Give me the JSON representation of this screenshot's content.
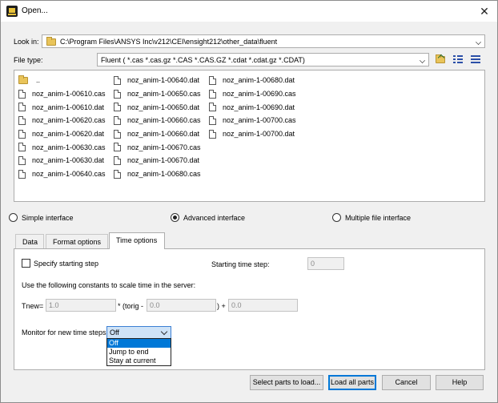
{
  "window": {
    "title": "Open...",
    "close_glyph": "✕"
  },
  "look_in": {
    "label": "Look in:",
    "path": "C:\\Program Files\\ANSYS Inc\\v212\\CEI\\ensight212\\other_data\\fluent"
  },
  "file_type": {
    "label": "File type:",
    "value": "Fluent ( *.cas *.cas.gz *.CAS *.CAS.GZ *.cdat *.cdat.gz *.CDAT)"
  },
  "toolbar": {
    "icons": [
      "up-folder-icon",
      "list-view-icon",
      "details-view-icon"
    ]
  },
  "files": {
    "col1": [
      "..",
      "noz_anim-1-00610.cas",
      "noz_anim-1-00610.dat",
      "noz_anim-1-00620.cas",
      "noz_anim-1-00620.dat",
      "noz_anim-1-00630.cas",
      "noz_anim-1-00630.dat",
      "noz_anim-1-00640.cas"
    ],
    "col2": [
      "noz_anim-1-00640.dat",
      "noz_anim-1-00650.cas",
      "noz_anim-1-00650.dat",
      "noz_anim-1-00660.cas",
      "noz_anim-1-00660.dat",
      "noz_anim-1-00670.cas",
      "noz_anim-1-00670.dat",
      "noz_anim-1-00680.cas"
    ],
    "col3": [
      "noz_anim-1-00680.dat",
      "noz_anim-1-00690.cas",
      "noz_anim-1-00690.dat",
      "noz_anim-1-00700.cas",
      "noz_anim-1-00700.dat"
    ]
  },
  "interface": {
    "simple": "Simple interface",
    "advanced": "Advanced interface",
    "multiple": "Multiple file interface",
    "selected": "advanced"
  },
  "tabs": [
    {
      "label": "Data"
    },
    {
      "label": "Format options"
    },
    {
      "label": "Time options"
    }
  ],
  "time_options": {
    "specify_start_label": "Specify starting step",
    "starting_step_label": "Starting time step:",
    "starting_step_value": "0",
    "constants_text": "Use the following constants to scale time in the server:",
    "tnew_label": "Tnew=",
    "tnew_value": "1.0",
    "torig_label": "* (torig -",
    "torig_value": "0.0",
    "plus_label": ") +",
    "plus_value": "0.0",
    "monitor_label": "Monitor for new time steps",
    "monitor_value": "Off",
    "monitor_options": [
      "Off",
      "Jump to end",
      "Stay at current"
    ]
  },
  "buttons": {
    "select_parts": "Select parts to load...",
    "load_all": "Load all parts",
    "cancel": "Cancel",
    "help": "Help"
  }
}
